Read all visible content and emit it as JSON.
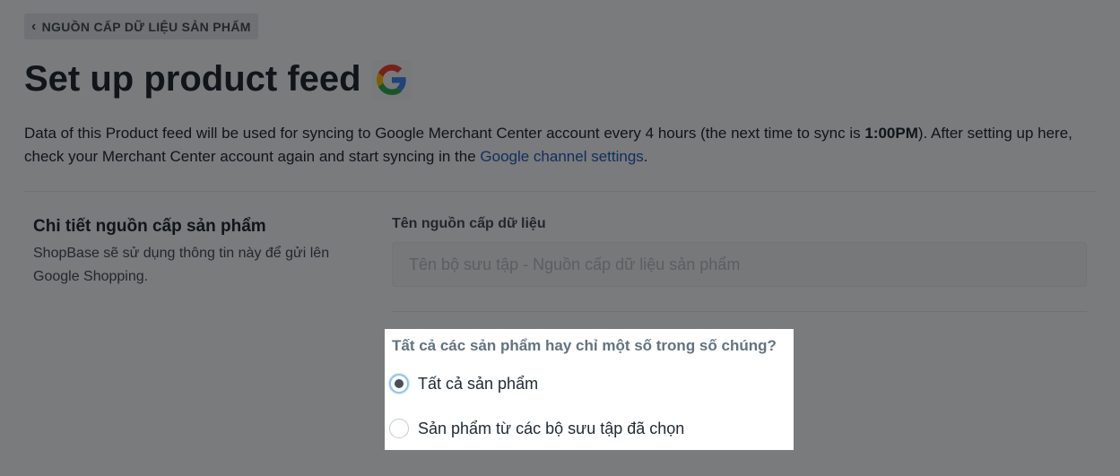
{
  "breadcrumb": {
    "label": "NGUỒN CẤP DỮ LIỆU SẢN PHẨM"
  },
  "header": {
    "title": "Set up product feed"
  },
  "description": {
    "part1": "Data of this Product feed will be used for syncing to Google Merchant Center account every 4 hours (the next time to sync is ",
    "sync_time": "1:00PM",
    "part2": "). After setting up here, check your Merchant Center account again and start syncing in the ",
    "link_text": "Google channel settings",
    "part3": "."
  },
  "section": {
    "title": "Chi tiết nguồn cấp sản phẩm",
    "description": "ShopBase sẽ sử dụng thông tin này để gửi lên Google Shopping."
  },
  "feed_name": {
    "label": "Tên nguồn cấp dữ liệu",
    "value": "",
    "placeholder": "Tên bộ sưu tập - Nguồn cấp dữ liệu sản phẩm"
  },
  "product_scope": {
    "question": "Tất cả các sản phẩm hay chỉ một số trong số chúng?",
    "options": [
      {
        "label": "Tất cả sản phẩm",
        "selected": true
      },
      {
        "label": "Sản phẩm từ các bộ sưu tập đã chọn",
        "selected": false
      }
    ]
  },
  "colors": {
    "link": "#1f5fbf",
    "text": "#212b36",
    "overlay": "rgba(0,0,0,0.5)",
    "google_blue": "#4285F4",
    "google_red": "#EA4335",
    "google_yellow": "#FBBC05",
    "google_green": "#34A853"
  },
  "icons": {
    "back": "chevron-left-icon",
    "logo": "google-logo-icon"
  }
}
